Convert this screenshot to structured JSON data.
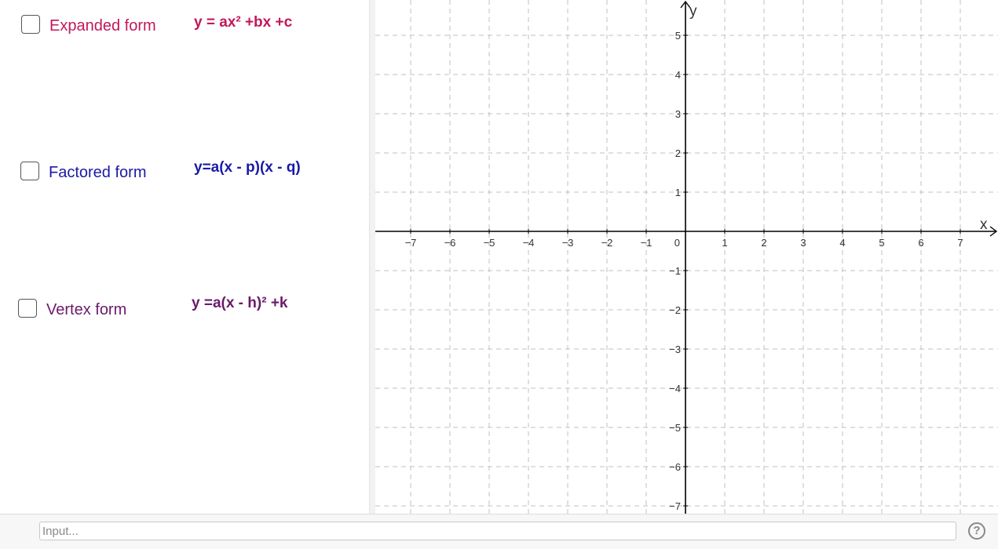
{
  "algebra_panel": {
    "options": [
      {
        "key": "expanded",
        "label": "Expanded form",
        "formula": "y = ax² +bx +c",
        "color": "#c2185b",
        "checked": false
      },
      {
        "key": "factored",
        "label": "Factored form",
        "formula": "y=a(x - p)(x - q)",
        "color": "#1a1aa6",
        "checked": false
      },
      {
        "key": "vertex",
        "label": "Vertex form",
        "formula": "y =a(x - h)² +k",
        "color": "#6a1b6a",
        "checked": false
      }
    ]
  },
  "graph": {
    "x_axis_label": "x",
    "y_axis_label": "y",
    "x_range": [
      -7,
      7
    ],
    "y_range": [
      -7,
      5
    ],
    "origin_label": "0",
    "x_tick_labels": [
      "−7",
      "−6",
      "−5",
      "−4",
      "−3",
      "−2",
      "−1",
      "1",
      "2",
      "3",
      "4",
      "5",
      "6",
      "7"
    ],
    "y_tick_labels": [
      "5",
      "4",
      "3",
      "2",
      "1",
      "−1",
      "−2",
      "−3",
      "−4",
      "−5",
      "−6",
      "−7"
    ],
    "grid": true,
    "grid_style": "dashed",
    "colors": {
      "axis": "#000000",
      "grid": "#c0c0c0",
      "labels": "#333333"
    }
  },
  "input_bar": {
    "placeholder": "Input...",
    "help_icon": "help-icon",
    "help_label": "?"
  }
}
